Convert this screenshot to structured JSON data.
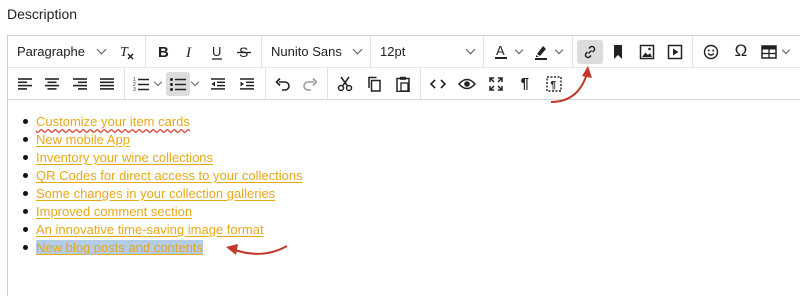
{
  "field": {
    "label": "Description"
  },
  "toolbar": {
    "block_format": "Paragraphe",
    "font_family": "Nunito Sans",
    "font_size": "12pt",
    "text_color_label": "A"
  },
  "content": {
    "items": [
      {
        "text": "Customize your item cards"
      },
      {
        "text": "New mobile App"
      },
      {
        "text": "Inventory your wine collections "
      },
      {
        "text": "QR Codes for direct access to your collections"
      },
      {
        "text": "Some changes in your collection galleries"
      },
      {
        "text": "Improved comment section"
      },
      {
        "text": "An innovative time-saving image format"
      },
      {
        "text": "New blog posts and contents"
      }
    ]
  },
  "colors": {
    "link": "#e8a916",
    "selection": "#b3cde8",
    "annotation_arrow": "#c0392b",
    "active_button": "#dcdcdc"
  },
  "icons": [
    "clear-format-icon",
    "bold-icon",
    "italic-icon",
    "underline-icon",
    "strikethrough-icon",
    "text-color-icon",
    "highlight-icon",
    "link-icon",
    "bookmark-icon",
    "image-icon",
    "media-icon",
    "emoticon-icon",
    "special-char-icon",
    "table-icon",
    "align-left-icon",
    "align-center-icon",
    "align-right-icon",
    "align-justify-icon",
    "numbered-list-icon",
    "bullet-list-icon",
    "outdent-icon",
    "indent-icon",
    "undo-icon",
    "redo-icon",
    "cut-icon",
    "copy-icon",
    "paste-icon",
    "code-icon",
    "preview-icon",
    "fullscreen-icon",
    "paragraph-mark-icon",
    "show-blocks-icon"
  ]
}
